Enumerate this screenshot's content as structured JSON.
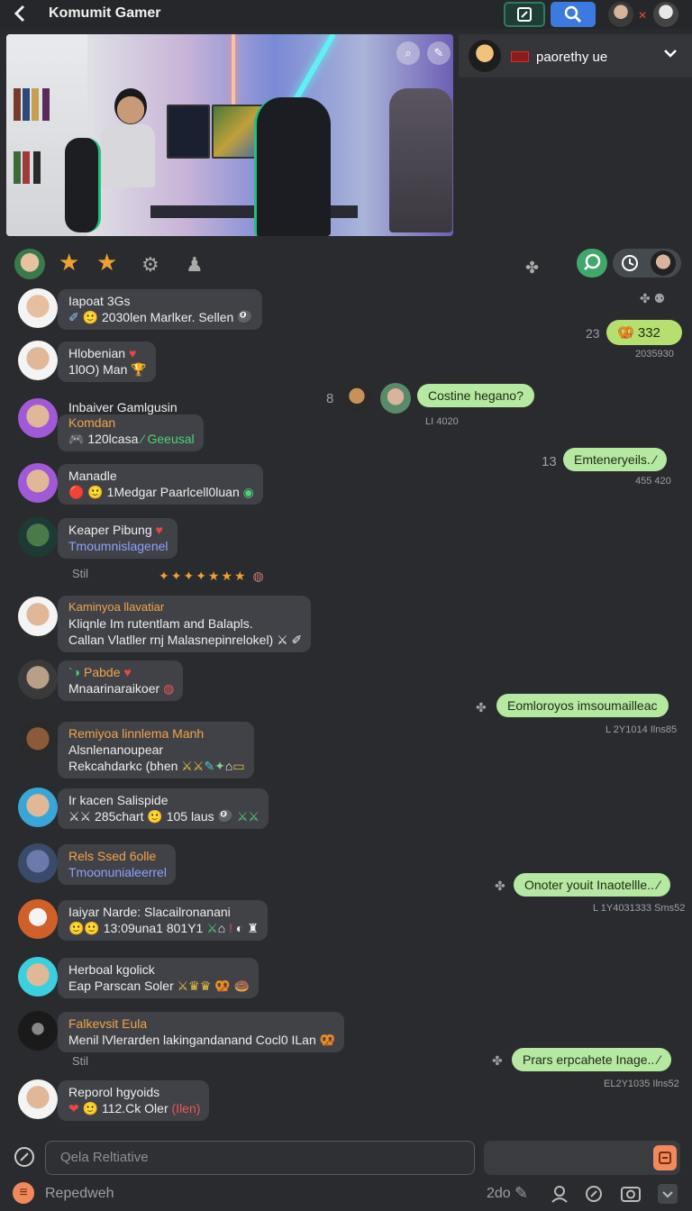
{
  "header": {
    "title": "Komumit Gamer"
  },
  "right_header": {
    "name": "paorethy ue"
  },
  "left_messages": [
    {
      "line1": "Iapoat 3Gs",
      "line2": "2030len Marlker. Sellen"
    },
    {
      "line1": "Hlobenian",
      "line2": "1l0O) Man"
    },
    {
      "line1": "Inbaiver Gamlgusin",
      "line2": "Komdan",
      "line3": "120lcasa",
      "line3b": "Geeusal"
    },
    {
      "line1": "Manadle",
      "line2": "1Medgar Paarlcell0luan"
    },
    {
      "line1": "Keaper Pibung",
      "line2": "Tmoumnislagenel"
    },
    {
      "line1": "Kaminyoa llavatiar",
      "line2": "Kliqnle Im rutentlam and Balapls.",
      "line3": "Callan Vlatller rnj Malasnepinrelokel)"
    },
    {
      "line1": "Pabde",
      "line2": "Mnaarinaraikoer"
    },
    {
      "line1": "Remiyoa linnlema Manh",
      "line2": "Alsnlenanoupear",
      "line3": "Rekcahdarkc (bhen"
    },
    {
      "line1": "Ir kacen Salispide",
      "line2": "285chart",
      "line2b": "105 laus"
    },
    {
      "line1": "Rels Ssed 6olle",
      "line2": "Tmoonunialeerrel"
    },
    {
      "line1": "Iaiyar Narde: Slacailronanani",
      "line2": "13:09una1 801Y1"
    },
    {
      "line1": "Herboal kgolick",
      "line2": "Eap Parscan Soler"
    },
    {
      "line1": "Falkevsit Eula",
      "line2": "Menil lVlerarden lakingandanand Cocl0 ILan"
    },
    {
      "line1": "Reporol hgyoids",
      "line2": "112.Ck Oler",
      "line2b": "(Ilen)"
    }
  ],
  "small_labels": {
    "stil1": "Stil",
    "stil2": "Stil"
  },
  "right_messages": [
    {
      "count": "23",
      "text": "332",
      "time": "2035930"
    },
    {
      "count": "8",
      "text": "Costine hegano?",
      "time": "LI 4020"
    },
    {
      "count": "13",
      "text": "Emteneryeils.",
      "time": "455 420"
    },
    {
      "text": "Eomloroyos imsoumailleac",
      "time": "L 2Y1014 Ilns85"
    },
    {
      "text": "Onoter youit Inaotellle..",
      "time": "L 1Y4031333 Sms52"
    },
    {
      "text": "Prars erpcahete Inage..",
      "time": "EL2Y1035 Ilns52"
    }
  ],
  "composer": {
    "placeholder": "Qela Reltiative"
  },
  "bottom": {
    "label": "Repedweh",
    "count": "2do"
  },
  "colors": {
    "bg": "#2a2b2e",
    "bubble_left": "#414247",
    "bubble_right": "#b5e8a0",
    "accent_blue": "#3d7ae0"
  }
}
